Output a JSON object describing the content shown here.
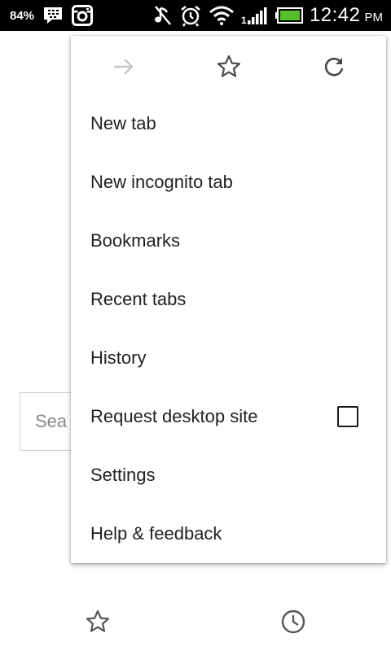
{
  "status_bar": {
    "battery_percent": "84%",
    "time": "12:42",
    "ampm": "PM",
    "icons": [
      "bbm-icon",
      "instagram-icon",
      "music-muted-icon",
      "alarm-icon",
      "wifi-icon",
      "signal-icon",
      "battery-icon"
    ]
  },
  "page": {
    "search_placeholder": "Sea",
    "bottom_icons": [
      "star-icon",
      "clock-icon"
    ]
  },
  "menu": {
    "toolbar": [
      "forward-icon",
      "bookmark-star-icon",
      "reload-icon"
    ],
    "items": [
      {
        "label": "New tab"
      },
      {
        "label": "New incognito tab"
      },
      {
        "label": "Bookmarks"
      },
      {
        "label": "Recent tabs"
      },
      {
        "label": "History"
      },
      {
        "label": "Request desktop site",
        "checkbox": false
      },
      {
        "label": "Settings"
      },
      {
        "label": "Help & feedback"
      }
    ]
  },
  "colors": {
    "status_bar_bg": "#000000",
    "menu_bg": "#ffffff",
    "disabled_icon": "#c8c8c8",
    "icon": "#4a4a4a",
    "battery_fill": "#56c02b"
  }
}
